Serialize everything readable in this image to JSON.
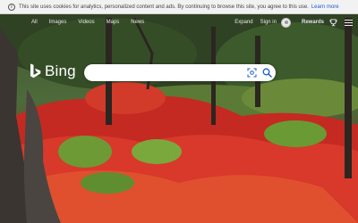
{
  "cookie": {
    "text": "This site uses cookies for analytics, personalized content and ads. By continuing to browse this site, you agree to this use.",
    "learn_more": "Learn more"
  },
  "nav": {
    "links": [
      "All",
      "Images",
      "Videos",
      "Maps",
      "News"
    ],
    "expand": "Expand",
    "sign_in": "Sign in",
    "rewards": "Rewards"
  },
  "logo": {
    "word": "Bing"
  },
  "search": {
    "value": "",
    "placeholder": ""
  },
  "colors": {
    "bing_brand": "#ffffff",
    "search_accent": "#1a5ed0",
    "foliage_red": "#d8322a",
    "foliage_green": "#5a8a2e"
  },
  "icons": [
    "info-icon",
    "avatar-icon",
    "trophy-icon",
    "menu-icon",
    "bing-logo-icon",
    "visual-search-icon",
    "search-icon"
  ]
}
